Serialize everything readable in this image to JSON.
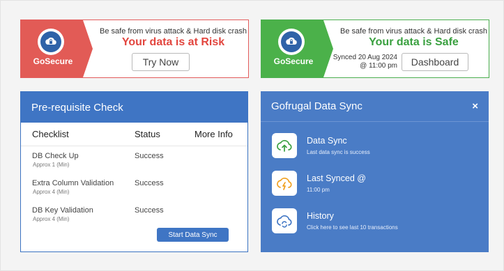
{
  "risk_banner": {
    "brand": "GoSecure",
    "tagline": "Be safe from virus attack & Hard disk crash",
    "headline": "Your data is at Risk",
    "button": "Try Now"
  },
  "safe_banner": {
    "brand": "GoSecure",
    "tagline": "Be safe from virus attack & Hard disk crash",
    "headline": "Your data is Safe",
    "synced_line1": "Synced 20 Aug 2024",
    "synced_line2": "@ 11:00 pm",
    "button": "Dashboard"
  },
  "prereq": {
    "title": "Pre-requisite Check",
    "columns": [
      "Checklist",
      "Status",
      "More Info"
    ],
    "rows": [
      {
        "name": "DB Check Up",
        "approx": "Approx 1 (Min)",
        "status": "Success"
      },
      {
        "name": "Extra Column Validation",
        "approx": "Approx 4 (Min)",
        "status": "Success"
      },
      {
        "name": "DB Key Validation",
        "approx": "Approx 4 (Min)",
        "status": "Success"
      }
    ],
    "button": "Start Data Sync"
  },
  "sync_panel": {
    "title": "Gofrugal Data Sync",
    "close": "×",
    "items": [
      {
        "title": "Data Sync",
        "subtitle": "Last data sync is success",
        "icon": "cloud-upload-icon"
      },
      {
        "title": "Last Synced @",
        "subtitle": "11:00 pm",
        "icon": "cloud-lightning-icon"
      },
      {
        "title": "History",
        "subtitle": "Click here to see last 10 transactions",
        "icon": "cloud-refresh-icon"
      }
    ]
  },
  "colors": {
    "risk": "#e25b56",
    "safe": "#4bb14a",
    "primary": "#3f75c4"
  }
}
